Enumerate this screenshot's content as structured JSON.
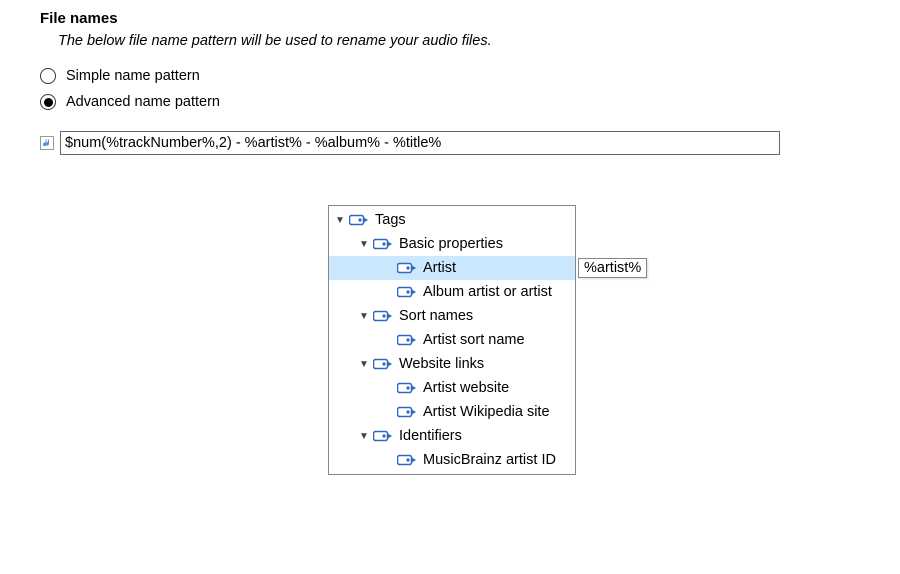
{
  "heading": "File names",
  "subheading": "The below file name pattern will be used to rename your audio files.",
  "radios": {
    "simple": "Simple name pattern",
    "advanced": "Advanced name pattern"
  },
  "pattern": "$num(%trackNumber%,2) - %artist% - %album% - %title%",
  "tree": {
    "tags": "Tags",
    "basic": "Basic properties",
    "artist": "Artist",
    "albumArtistOrArtist": "Album artist or artist",
    "sortNames": "Sort names",
    "artistSortName": "Artist sort name",
    "websiteLinks": "Website links",
    "artistWebsite": "Artist website",
    "artistWikipedia": "Artist Wikipedia site",
    "identifiers": "Identifiers",
    "mbArtistId": "MusicBrainz artist ID"
  },
  "tooltip": "%artist%"
}
